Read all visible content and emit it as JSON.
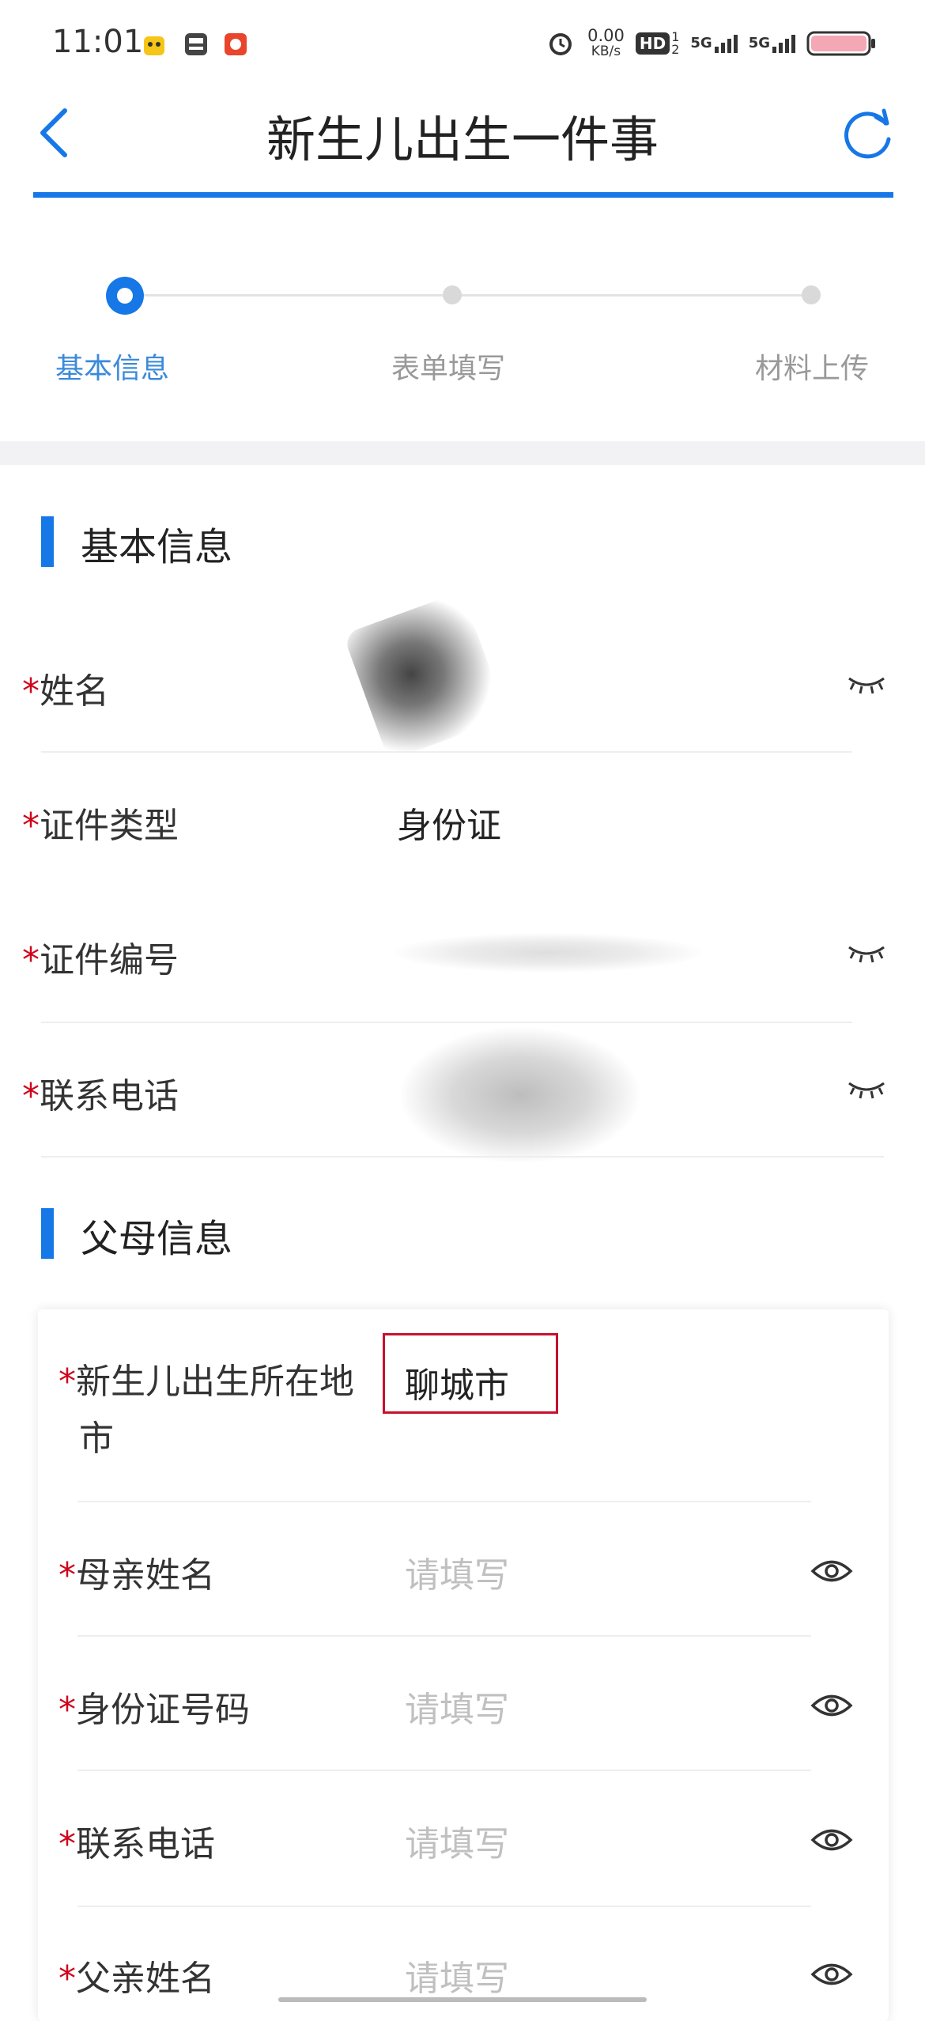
{
  "status_bar": {
    "time": "11:01",
    "net_speed_value": "0.00",
    "net_speed_unit": "KB/s",
    "hd_label": "HD",
    "signal_1": "5G",
    "signal_2": "5G"
  },
  "header": {
    "title": "新生儿出生一件事",
    "accent_color": "#1677e6"
  },
  "steps": [
    {
      "label": "基本信息",
      "active": true
    },
    {
      "label": "表单填写",
      "active": false
    },
    {
      "label": "材料上传",
      "active": false
    }
  ],
  "basic_info": {
    "section_title": "基本信息",
    "required_mark": "*",
    "fields": [
      {
        "label": "姓名",
        "value": ""
      },
      {
        "label": "证件类型",
        "value": "身份证"
      },
      {
        "label": "证件编号",
        "value": ""
      },
      {
        "label": "联系电话",
        "value": ""
      }
    ]
  },
  "parent_info": {
    "section_title": "父母信息",
    "required_mark": "*",
    "birth_city_label_line1": "新生儿出生所在地",
    "birth_city_label_line2": "市",
    "birth_city_value": "聊城市",
    "fields": [
      {
        "label": "母亲姓名",
        "placeholder": "请填写"
      },
      {
        "label": "身份证号码",
        "placeholder": "请填写"
      },
      {
        "label": "联系电话",
        "placeholder": "请填写"
      },
      {
        "label": "父亲姓名",
        "placeholder": "请填写"
      }
    ]
  }
}
